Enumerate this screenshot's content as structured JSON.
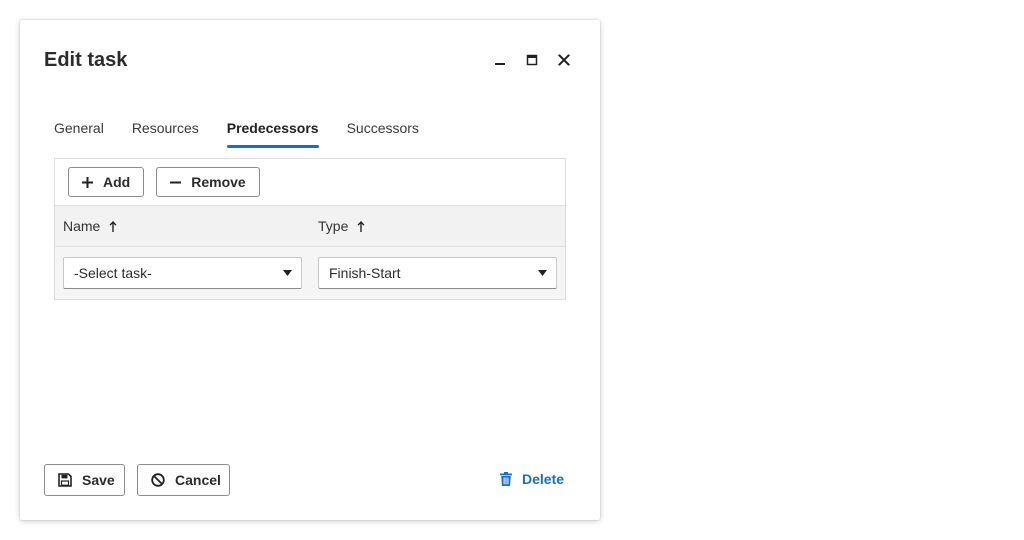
{
  "dialog": {
    "title": "Edit task",
    "controls": [
      "minimize-icon",
      "maximize-icon",
      "close-icon"
    ]
  },
  "tabs": [
    {
      "label": "General",
      "active": false
    },
    {
      "label": "Resources",
      "active": false
    },
    {
      "label": "Predecessors",
      "active": true
    },
    {
      "label": "Successors",
      "active": false
    }
  ],
  "toolbar": {
    "add_label": "Add",
    "add_icon": "plus-icon",
    "remove_label": "Remove",
    "remove_icon": "minus-icon"
  },
  "grid": {
    "columns": [
      {
        "label": "Name",
        "sort": "ascending",
        "sort_icon": "arrow-up-icon"
      },
      {
        "label": "Type",
        "sort": "ascending",
        "sort_icon": "arrow-up-icon"
      }
    ],
    "rows": [
      {
        "name": "-Select task-",
        "type": "Finish-Start"
      }
    ]
  },
  "footer": {
    "save_label": "Save",
    "save_icon": "floppy-disk-icon",
    "cancel_label": "Cancel",
    "cancel_icon": "ban-icon",
    "delete_label": "Delete",
    "delete_icon": "trash-icon"
  },
  "colors": {
    "accent": "#1a6fc4",
    "text": "#2b2b2b",
    "header_bg": "#f2f2f2"
  }
}
